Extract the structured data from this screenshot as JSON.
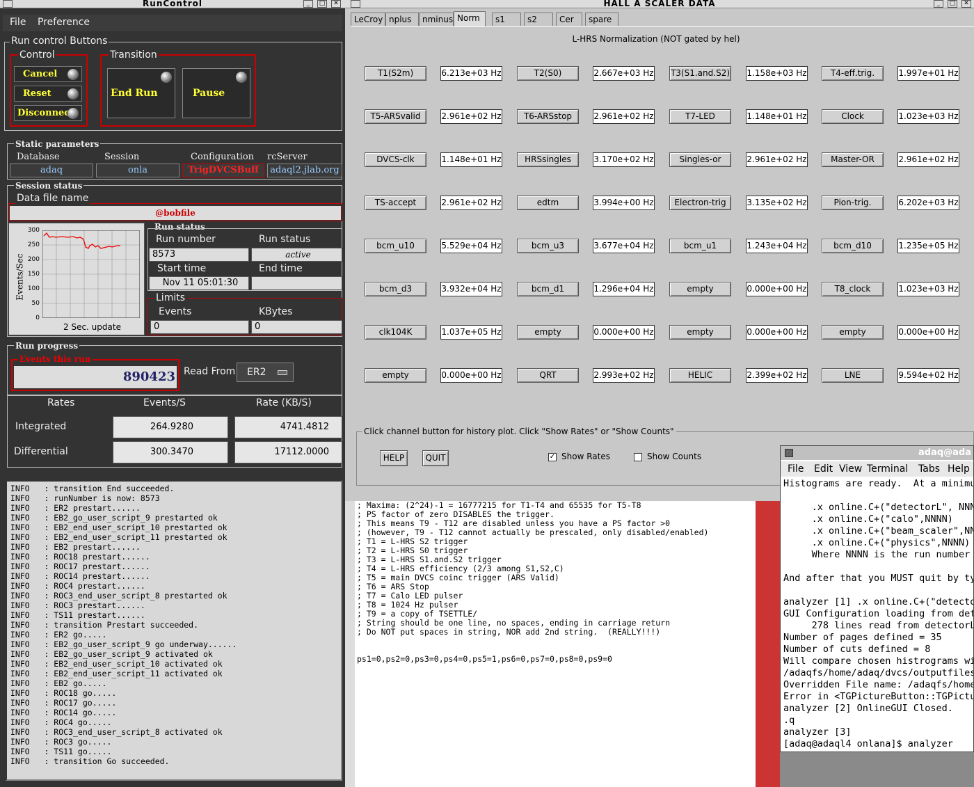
{
  "runcontrol": {
    "title": "RunControl",
    "menu": [
      "File",
      "Preference"
    ],
    "run_buttons_label": "Run control Buttons",
    "control_label": "Control",
    "transition_label": "Transition",
    "cancel": "Cancel",
    "reset": "Reset",
    "disconnect": "Disconnect",
    "end_run": "End Run",
    "pause": "Pause",
    "static_params_label": "Static parameters",
    "static_params": {
      "database_label": "Database",
      "database": "adaq",
      "session_label": "Session",
      "session": "onla",
      "config_label": "Configuration",
      "config": "TrigDVCSBuff",
      "rcserver_label": "rcServer",
      "rcserver": "adaql2.jlab.org"
    },
    "session_status_label": "Session status",
    "data_file_label": "Data file name",
    "data_file": "@bobfile",
    "plot": {
      "ylabel": "Events/Sec",
      "update": "2 Sec. update",
      "yticks": [
        "300",
        "250",
        "200",
        "150",
        "100",
        "50",
        "0"
      ]
    },
    "run_status_group": "Run status",
    "run_number_label": "Run number",
    "run_number": "8573",
    "run_status_label": "Run status",
    "run_status": "active",
    "start_time_label": "Start time",
    "start_time": "Nov 11 05:01:30",
    "end_time_label": "End time",
    "end_time": "",
    "limits_label": "Limits",
    "events_label": "Events",
    "events_limit": "0",
    "kbytes_label": "KBytes",
    "kbytes_limit": "0",
    "run_progress_label": "Run progress",
    "events_this_run_label": "Events this run",
    "events_this_run": "890423",
    "read_from_label": "Read From:",
    "read_from": "ER2",
    "rates_header": [
      "Rates",
      "Events/S",
      "Rate (KB/S)"
    ],
    "rates": [
      {
        "label": "Integrated",
        "events": "264.9280",
        "kb": "4741.4812"
      },
      {
        "label": "Differential",
        "events": "300.3470",
        "kb": "17112.0000"
      }
    ],
    "log": [
      "INFO   : transition End succeeded.",
      "INFO   : runNumber is now: 8573",
      "INFO   : ER2 prestart......",
      "INFO   : EB2_go_user_script_9 prestarted ok",
      "INFO   : EB2_end_user_script_10 prestarted ok",
      "INFO   : EB2_end_user_script_11 prestarted ok",
      "INFO   : EB2 prestart......",
      "INFO   : ROC18 prestart......",
      "INFO   : ROC17 prestart......",
      "INFO   : ROC14 prestart......",
      "INFO   : ROC4 prestart......",
      "INFO   : ROC3_end_user_script_8 prestarted ok",
      "INFO   : ROC3 prestart......",
      "INFO   : TS11 prestart......",
      "INFO   : transition Prestart succeeded.",
      "INFO   : ER2 go.....",
      "INFO   : EB2_go_user_script_9 go underway......",
      "INFO   : EB2_go_user_script_9 activated ok",
      "INFO   : EB2_end_user_script_10 activated ok",
      "INFO   : EB2_end_user_script_11 activated ok",
      "INFO   : EB2 go.....",
      "INFO   : ROC18 go.....",
      "INFO   : ROC17 go.....",
      "INFO   : ROC14 go.....",
      "INFO   : ROC4 go.....",
      "INFO   : ROC3_end_user_script_8 activated ok",
      "INFO   : ROC3 go.....",
      "INFO   : TS11 go.....",
      "INFO   : transition Go succeeded."
    ]
  },
  "scaler": {
    "title": "HALL  A   SCALER   DATA",
    "tabs": [
      "LeCroy",
      "nplus",
      "nminus",
      "Norm",
      "s1",
      "s2",
      "Cer",
      "spare"
    ],
    "active_tab": "Norm",
    "heading": "L-HRS Normalization (NOT gated by hel)",
    "channels": [
      [
        [
          "T1(S2m)",
          "6.213e+03 Hz"
        ],
        [
          "T2(S0)",
          "2.667e+03 Hz"
        ],
        [
          "T3(S1.and.S2)",
          "1.158e+03 Hz"
        ],
        [
          "T4-eff.trig.",
          "1.997e+01 Hz"
        ]
      ],
      [
        [
          "T5-ARSvalid",
          "2.961e+02 Hz"
        ],
        [
          "T6-ARSstop",
          "2.961e+02 Hz"
        ],
        [
          "T7-LED",
          "1.148e+01 Hz"
        ],
        [
          "Clock",
          "1.023e+03 Hz"
        ]
      ],
      [
        [
          "DVCS-clk",
          "1.148e+01 Hz"
        ],
        [
          "HRSsingles",
          "3.170e+02 Hz"
        ],
        [
          "Singles-or",
          "2.961e+02 Hz"
        ],
        [
          "Master-OR",
          "2.961e+02 Hz"
        ]
      ],
      [
        [
          "TS-accept",
          "2.961e+02 Hz"
        ],
        [
          "edtm",
          "3.994e+00 Hz"
        ],
        [
          "Electron-trig",
          "3.135e+02 Hz"
        ],
        [
          "Pion-trig.",
          "6.202e+03 Hz"
        ]
      ],
      [
        [
          "bcm_u10",
          "5.529e+04 Hz"
        ],
        [
          "bcm_u3",
          "3.677e+04 Hz"
        ],
        [
          "bcm_u1",
          "1.243e+04 Hz"
        ],
        [
          "bcm_d10",
          "1.235e+05 Hz"
        ]
      ],
      [
        [
          "bcm_d3",
          "3.932e+04 Hz"
        ],
        [
          "bcm_d1",
          "1.296e+04 Hz"
        ],
        [
          "empty",
          "0.000e+00 Hz"
        ],
        [
          "T8_clock",
          "1.023e+03 Hz"
        ]
      ],
      [
        [
          "clk104K",
          "1.037e+05 Hz"
        ],
        [
          "empty",
          "0.000e+00 Hz"
        ],
        [
          "empty",
          "0.000e+00 Hz"
        ],
        [
          "empty",
          "0.000e+00 Hz"
        ]
      ],
      [
        [
          "empty",
          "0.000e+00 Hz"
        ],
        [
          "QRT",
          "2.993e+02 Hz"
        ],
        [
          "HELIC",
          "2.399e+02 Hz"
        ],
        [
          "LNE",
          "9.594e+02 Hz"
        ]
      ]
    ],
    "footer_text": "Click channel button for history plot.  Click \"Show Rates\" or \"Show Counts\"",
    "help": "HELP",
    "quit": "QUIT",
    "show_rates": "Show Rates",
    "show_counts": "Show Counts"
  },
  "editor": {
    "lines": [
      "; Maxima: (2^24)-1 = 16777215 for T1-T4 and 65535 for T5-T8",
      "; PS factor of zero DISABLES the trigger.",
      "; This means T9 - T12 are disabled unless you have a PS factor >0",
      "; (however, T9 - T12 cannot actually be prescaled, only disabled/enabled)",
      "; T1 = L-HRS S2 trigger",
      "; T2 = L-HRS S0 trigger",
      "; T3 = L-HRS S1.and.S2 trigger",
      "; T4 = L-HRS efficiency (2/3 among S1,S2,C)",
      "; T5 = main DVCS coinc trigger (ARS Valid)",
      "; T6 = ARS Stop",
      "; T7 = Calo LED pulser",
      "; T8 = 1024 Hz pulser",
      "; T9 = a copy of TSETTLE/",
      "; String should be one line, no spaces, ending in carriage return",
      "; Do NOT put spaces in string, NOR add 2nd string.  (REALLY!!!)",
      "",
      "",
      "ps1=0,ps2=0,ps3=0,ps4=0,ps5=1,ps6=0,ps7=0,ps8=0,ps9=0"
    ]
  },
  "terminal": {
    "title": "adaq@ada",
    "menu": [
      "File",
      "Edit",
      "View",
      "Terminal",
      "Tabs",
      "Help"
    ],
    "lines": [
      "Histograms are ready.  At a minimu",
      "",
      "     .x online.C+(\"detectorL\", NNN",
      "     .x online.C+(\"calo\",NNNN)",
      "     .x online.C+(\"beam_scaler\",NN",
      "     .x online.C+(\"physics\",NNNN)",
      "     Where NNNN is the run number",
      "",
      "And after that you MUST quit by typ",
      "",
      "analyzer [1] .x online.C+(\"detecto",
      "GUI Configuration loading from dete",
      "     278 lines read from detectorL",
      "Number of pages defined = 35",
      "Number of cuts defined = 8",
      "Will compare chosen histrograms wit",
      "/adaqfs/home/adaq/dvcs/outputfiles,",
      "Overridden File name: /adaqfs/home,",
      "Error in <TGPictureButton::TGPictu",
      "analyzer [2] OnlineGUI Closed.",
      ".q",
      "analyzer [3]",
      "[adaq@adaql4 onlana]$ analyzer"
    ]
  },
  "colors": {
    "accent_red": "#cc0000",
    "button_yellow": "#ffff33",
    "value_blue": "#99ccff"
  }
}
